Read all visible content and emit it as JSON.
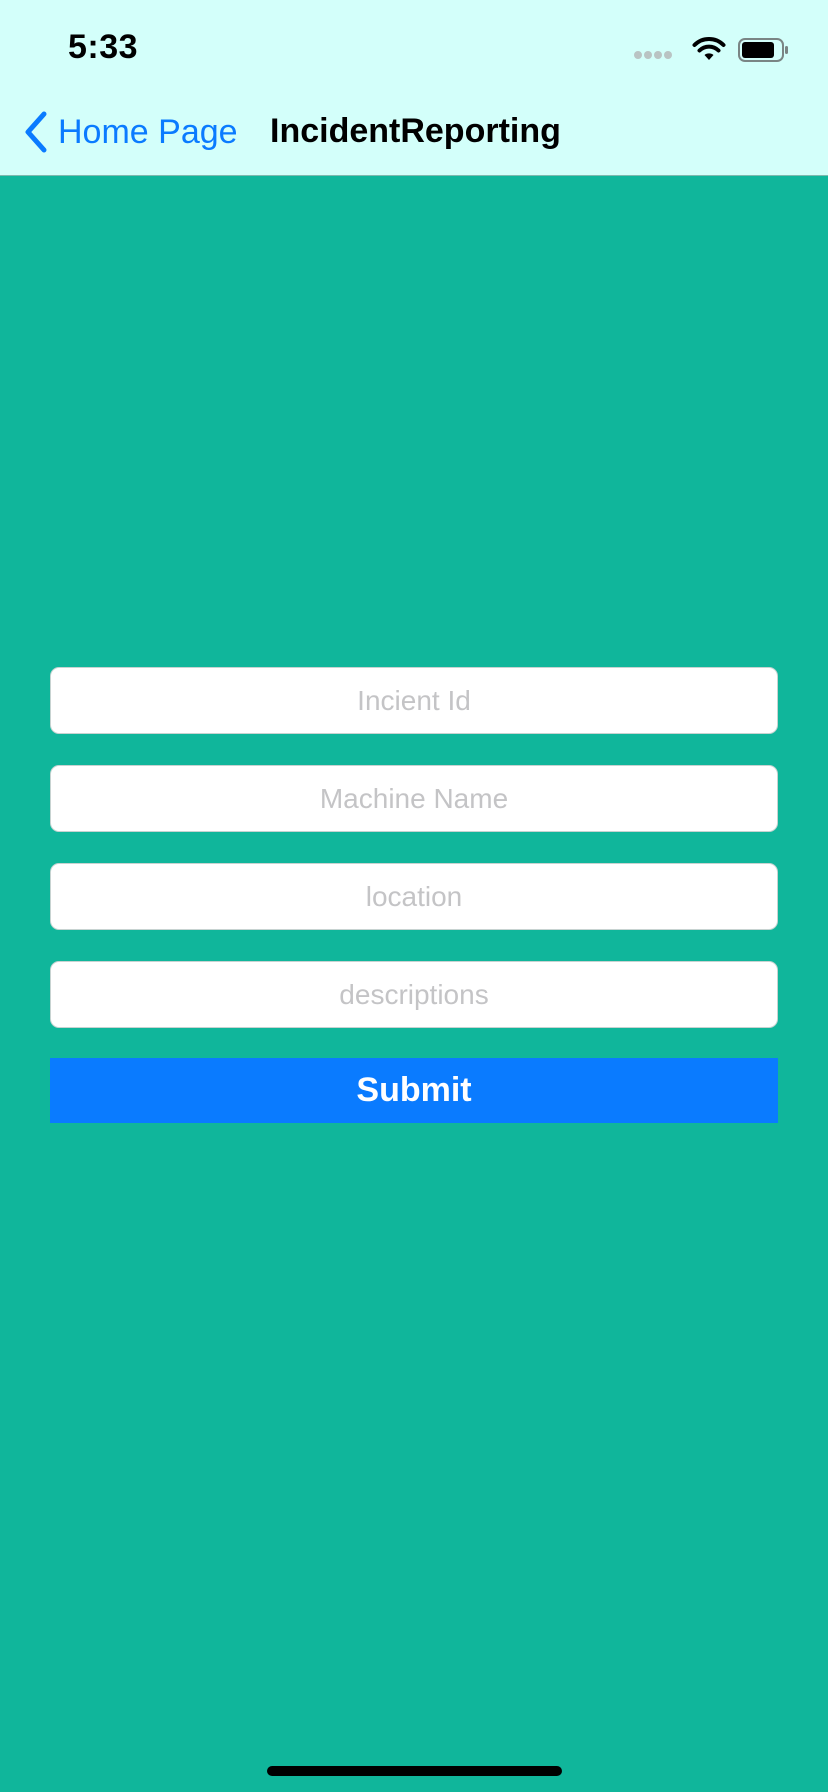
{
  "status_bar": {
    "time": "5:33",
    "icons": [
      "cellular-signal-icon",
      "wifi-icon",
      "battery-icon"
    ]
  },
  "nav": {
    "back_label": "Home Page",
    "title": "IncidentReporting"
  },
  "form": {
    "fields": [
      {
        "placeholder": "Incient Id",
        "value": ""
      },
      {
        "placeholder": "Machine Name",
        "value": ""
      },
      {
        "placeholder": "location",
        "value": ""
      },
      {
        "placeholder": "descriptions",
        "value": ""
      }
    ],
    "submit_label": "Submit"
  },
  "colors": {
    "background": "#10b69b",
    "nav_bar": "#d3fffa",
    "accent": "#0a7bff"
  }
}
